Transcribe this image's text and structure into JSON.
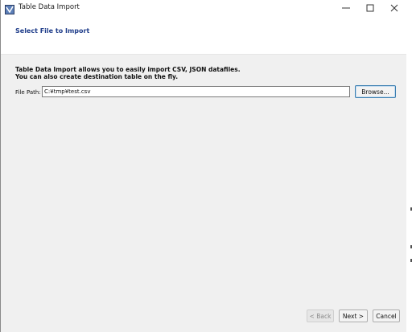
{
  "window": {
    "title": "Table Data Import",
    "app_icon": "table-import-icon",
    "controls": [
      "minimize-icon",
      "maximize-icon",
      "close-icon"
    ]
  },
  "wizard": {
    "step_title": "Select File to Import",
    "description_line1": "Table Data Import allows you to easily import CSV, JSON datafiles.",
    "description_line2": "You can also create destination table on the fly."
  },
  "file_path": {
    "label": "File Path:",
    "value": "C:¥tmp¥test.csv",
    "browse_label": "Browse..."
  },
  "footer": {
    "back_label": "< Back",
    "back_enabled": false,
    "next_label": "Next >",
    "cancel_label": "Cancel"
  },
  "colors": {
    "step_title": "#1f3d8a",
    "window_bg": "#f0f0f0",
    "focus_border": "#3c7fb1"
  }
}
